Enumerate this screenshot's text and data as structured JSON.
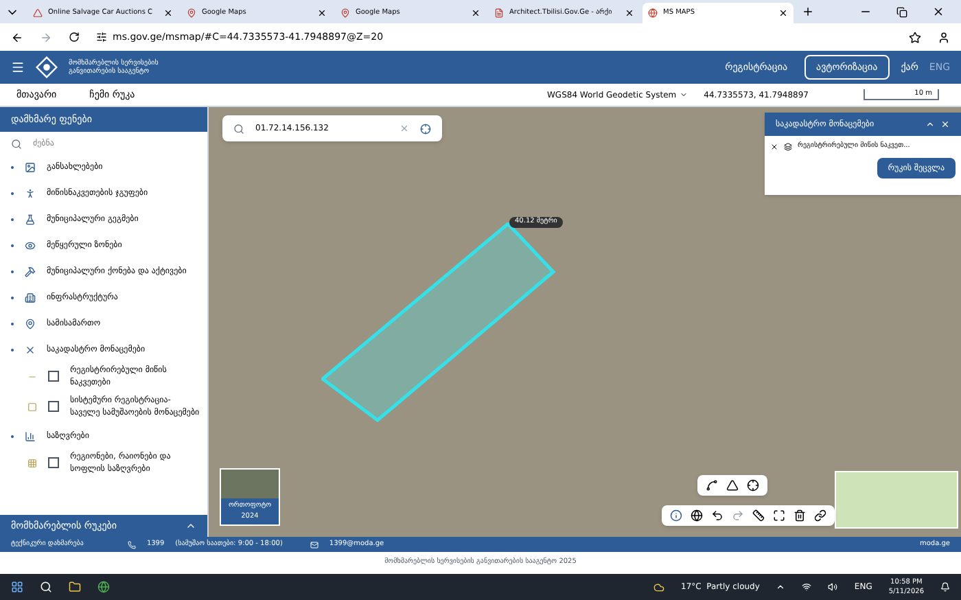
{
  "browser": {
    "tabs": [
      {
        "title": "Online Salvage Car Auctions C",
        "selected": false
      },
      {
        "title": "Google Maps",
        "selected": false
      },
      {
        "title": "Google Maps",
        "selected": false
      },
      {
        "title": "Architect.Tbilisi.Gov.Ge - არქი",
        "selected": false
      },
      {
        "title": "MS MAPS",
        "selected": true
      }
    ],
    "url": "ms.gov.ge/msmap/#C=44.7335573-41.7948897@Z=20"
  },
  "header": {
    "logo_text": "მომხმარებლის სერვისების განვითარების სააგენტო",
    "register": "რეგისტრაცია",
    "login": "ავტორიზაცია",
    "languages": [
      {
        "label": "ქარ",
        "selected": true
      },
      {
        "label": "ENG",
        "selected": false
      }
    ]
  },
  "subbar": {
    "links": [
      "მთავარი",
      "ჩემი რუკა"
    ],
    "crs": "WGS84 World Geodetic System",
    "coords": "44.7335573, 41.7948897",
    "scale": "10 m"
  },
  "sidebar": {
    "title": "დამხმარე ფენები",
    "search_placeholder": "ძებნა",
    "items": [
      {
        "label": "განსახლებები"
      },
      {
        "label": "მიწისნაკვეთების ჯგუფები"
      },
      {
        "label": "მუნიციპალური გეგმები"
      },
      {
        "label": "მეწყერული ზონები"
      },
      {
        "label": "მუნიციპალური ქონება და აქტივები"
      },
      {
        "label": "ინფრასტრუქტურა"
      },
      {
        "label": "სამისამართო"
      },
      {
        "label": "საკადასტრო მონაცემები",
        "children": [
          {
            "label": "რეგისტრირებული მიწის ნაკვეთები",
            "checked": false
          },
          {
            "label": "სისტემური რეგისტრაცია-საველე სამუშაოების მონაცემები",
            "checked": false
          }
        ]
      },
      {
        "label": "საზღვრები",
        "children": [
          {
            "label": "რეგიონები, რაიონები და სოფლის საზღვრები",
            "checked": false
          }
        ]
      }
    ],
    "footer": "მომხმარებლის რუკები"
  },
  "map": {
    "search_value": "01.72.14.156.132",
    "measure_label": "40.12 მეტრი",
    "basemap_label": "ორთოფოტო 2024"
  },
  "cadastre_panel": {
    "title": "საკადასტრო მონაცემები",
    "layer": "რეგისტრირებული მიწის ნაკვეთ...",
    "button": "რუკის შეცვლა"
  },
  "footer": {
    "support": "ტექნიკური დახმარება",
    "phone": "1399",
    "hours": "(სამუშაო საათები: 9:00 - 18:00)",
    "email": "1399@moda.ge",
    "site": "moda.ge",
    "copyright": "მომხმარებლის სერვისების განვითარების სააგენტო 2025"
  },
  "taskbar": {
    "weather": "17°C  Partly cloudy",
    "language": "ENG",
    "time": "10:58 PM",
    "date": "5/11/2026"
  }
}
